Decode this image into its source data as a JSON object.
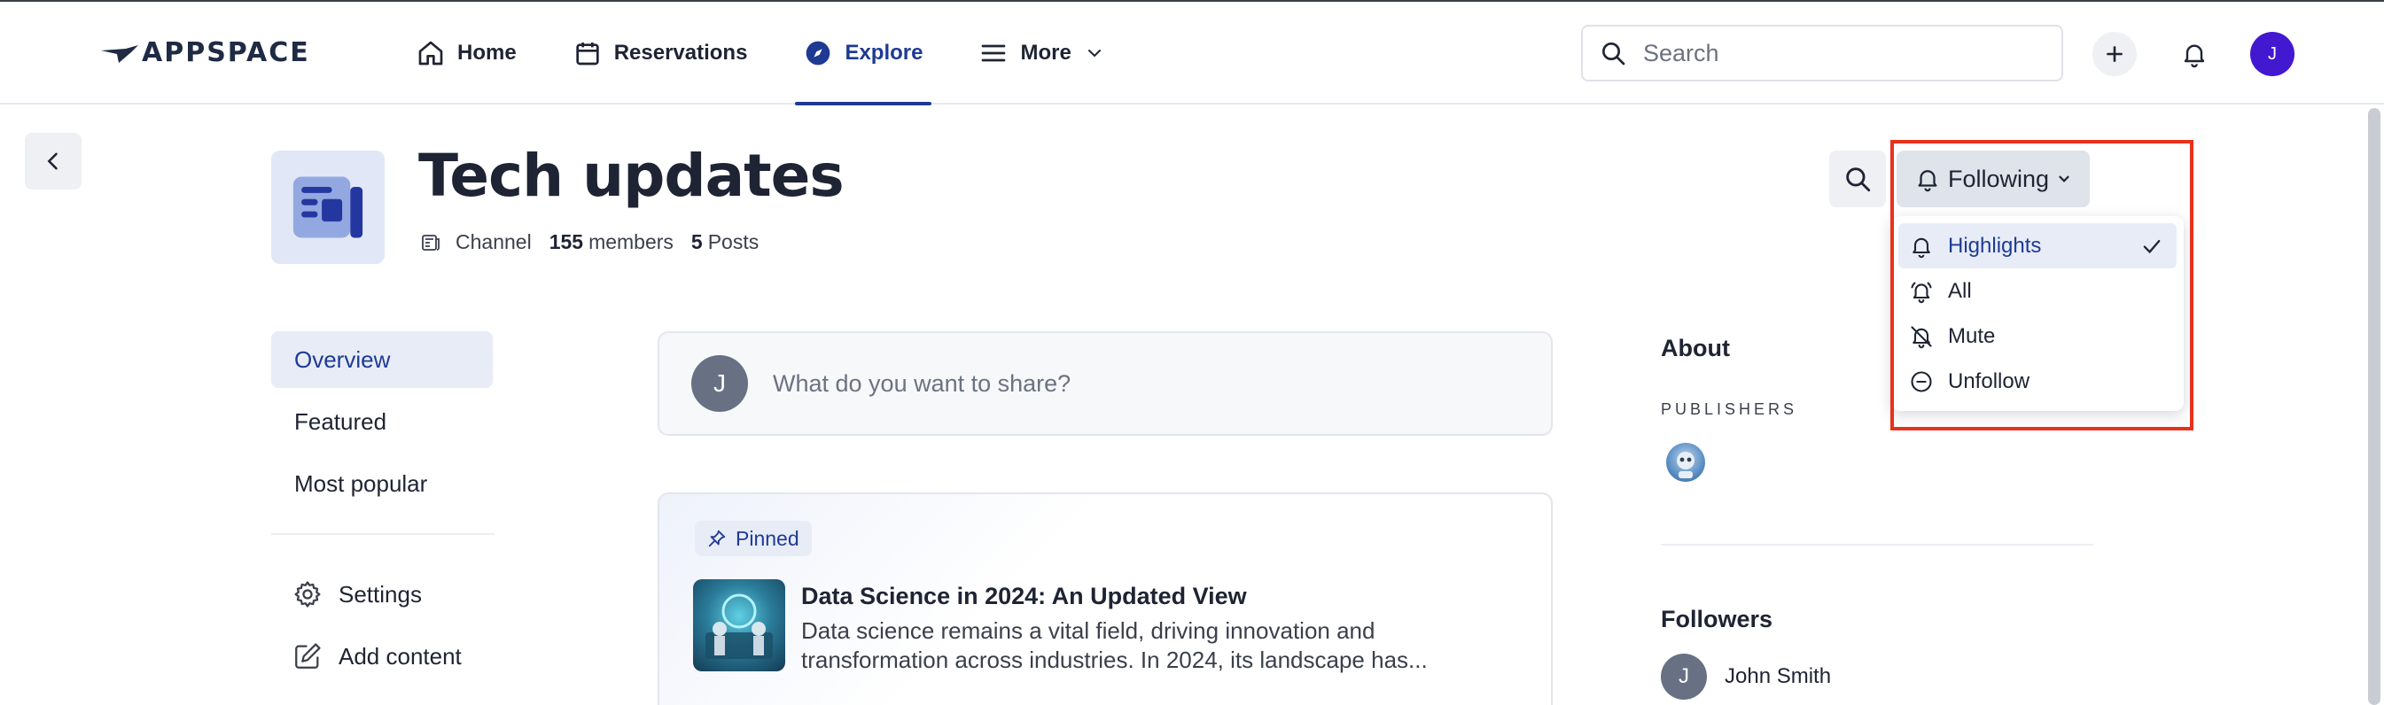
{
  "brand": {
    "name": "APPSPACE",
    "accent": "#1f3a93",
    "avatar_color": "#4318d1",
    "highlight_color": "#e8321d"
  },
  "nav": {
    "items": [
      {
        "label": "Home",
        "icon": "home-icon"
      },
      {
        "label": "Reservations",
        "icon": "calendar-icon"
      },
      {
        "label": "Explore",
        "icon": "compass-icon",
        "active": true
      },
      {
        "label": "More",
        "icon": "menu-icon"
      }
    ]
  },
  "search": {
    "placeholder": "Search",
    "value": ""
  },
  "user": {
    "initial": "J"
  },
  "channel": {
    "title": "Tech updates",
    "type": "Channel",
    "members_count": "155",
    "members_label": "members",
    "posts_count": "5",
    "posts_label": "Posts"
  },
  "follow": {
    "button_label": "Following",
    "options": [
      {
        "label": "Highlights",
        "icon": "bell-icon",
        "selected": true
      },
      {
        "label": "All",
        "icon": "bell-ring-icon"
      },
      {
        "label": "Mute",
        "icon": "bell-off-icon"
      },
      {
        "label": "Unfollow",
        "icon": "minus-circle-icon"
      }
    ]
  },
  "sidebar": {
    "items": [
      {
        "label": "Overview",
        "active": true
      },
      {
        "label": "Featured"
      },
      {
        "label": "Most popular"
      }
    ],
    "actions": [
      {
        "label": "Settings",
        "icon": "gear-icon"
      },
      {
        "label": "Add content",
        "icon": "edit-icon"
      }
    ]
  },
  "composer": {
    "avatar_initial": "J",
    "placeholder": "What do you want to share?"
  },
  "post": {
    "badge": "Pinned",
    "title": "Data Science in 2024: An Updated View",
    "excerpt": "Data science remains a vital field, driving innovation and transformation across industries. In 2024, its landscape has..."
  },
  "about": {
    "title": "About",
    "publishers_label": "PUBLISHERS",
    "followers_title": "Followers",
    "followers": [
      {
        "initial": "J",
        "name": "John Smith"
      }
    ]
  }
}
